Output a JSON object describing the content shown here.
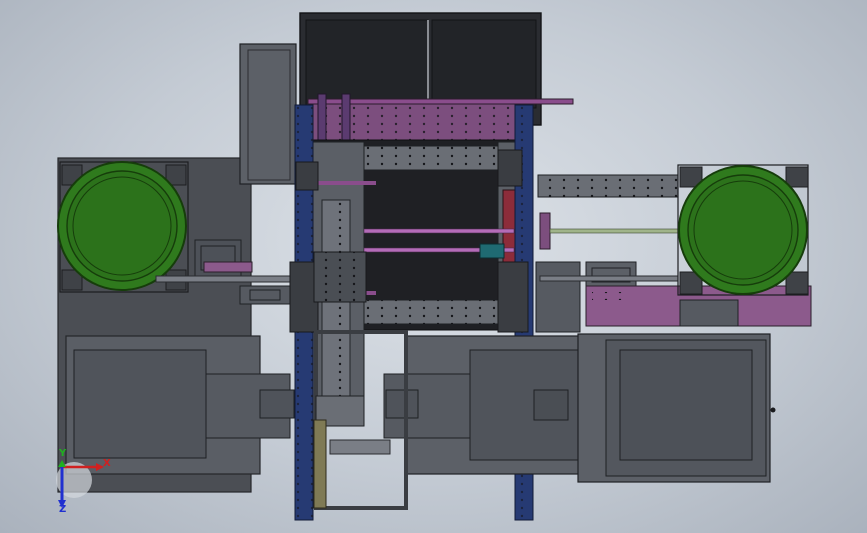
{
  "view": {
    "background": "#c4cbd4",
    "triad": {
      "x_label": "X",
      "y_label": "Y",
      "z_label": "Z",
      "x_color": "#d02020",
      "y_color": "#20b020",
      "z_color": "#2030d0"
    }
  },
  "colors": {
    "frame_dark": "#4d5158",
    "frame_mid": "#62666d",
    "plate_dark": "#2a2c31",
    "bowl_green": "#2f7a1d",
    "bowl_rim": "#1a4d0e",
    "rail_blue": "#263a73",
    "purple": "#7a4a7c",
    "magenta_rod": "#b46cb8",
    "teal": "#1f6a72",
    "olive": "#7f7a55"
  }
}
